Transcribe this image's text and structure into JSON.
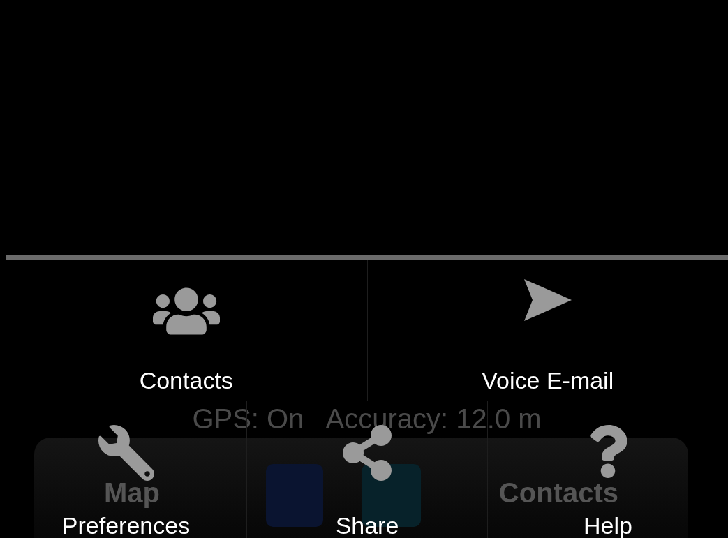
{
  "background_app": {
    "status": "GPS: On   Accuracy: 12.0 m",
    "toolbar": [
      {
        "label": "Map"
      },
      {
        "label": "Contacts"
      }
    ]
  },
  "menu": {
    "top_items": [
      {
        "label": "Contacts"
      },
      {
        "label": "Voice E-mail"
      }
    ],
    "bottom_items": [
      {
        "label": "Preferences"
      },
      {
        "label": "Share"
      },
      {
        "label": "Help"
      }
    ]
  }
}
